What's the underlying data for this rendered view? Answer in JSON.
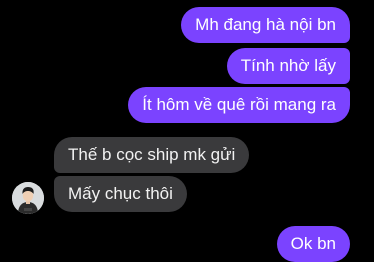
{
  "messages": {
    "outgoing": [
      "Mh đang hà nội bn",
      "Tính nhờ lấy",
      "Ít hôm về quê rồi mang ra"
    ],
    "incoming": [
      "Thế b cọc ship mk gửi",
      "Mấy chục thôi"
    ],
    "last_outgoing": "Ok bn"
  },
  "colors": {
    "outgoing_bubble": "#7b43ff",
    "incoming_bubble": "#3a3a3c",
    "background": "#000000"
  },
  "contact": {
    "avatar": "avatar-photo-icon"
  }
}
